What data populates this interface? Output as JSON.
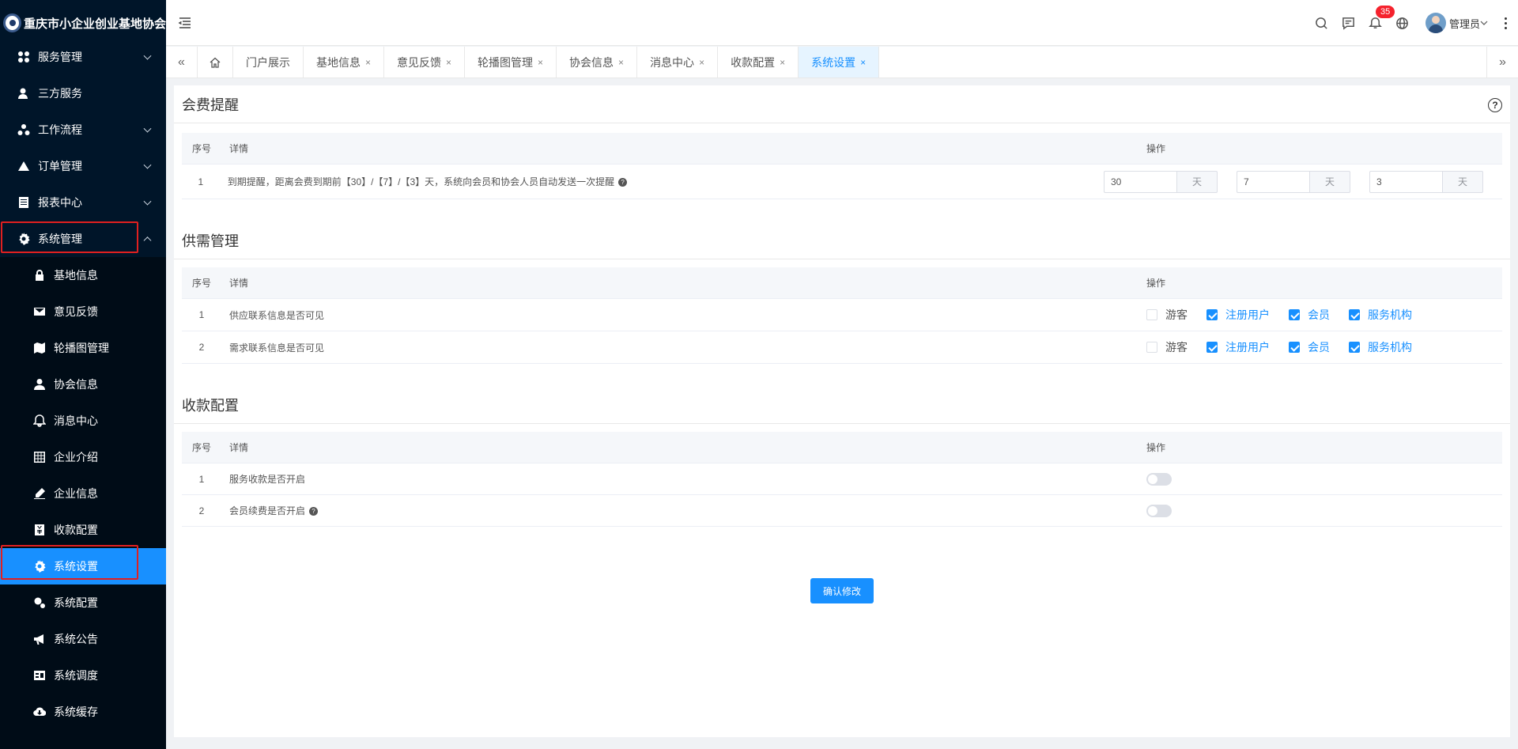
{
  "app": {
    "title": "重庆市小企业创业基地协会"
  },
  "sidebar": {
    "items": [
      {
        "label": "服务管理"
      },
      {
        "label": "三方服务"
      },
      {
        "label": "工作流程"
      },
      {
        "label": "订单管理"
      },
      {
        "label": "报表中心"
      },
      {
        "label": "系统管理"
      },
      {
        "label": "基地信息"
      },
      {
        "label": "意见反馈"
      },
      {
        "label": "轮播图管理"
      },
      {
        "label": "协会信息"
      },
      {
        "label": "消息中心"
      },
      {
        "label": "企业介绍"
      },
      {
        "label": "企业信息"
      },
      {
        "label": "收款配置"
      },
      {
        "label": "系统设置"
      },
      {
        "label": "系统配置"
      },
      {
        "label": "系统公告"
      },
      {
        "label": "系统调度"
      },
      {
        "label": "系统缓存"
      }
    ]
  },
  "header": {
    "notification_count": "35",
    "user_name": "管理员"
  },
  "tabs": [
    {
      "label": "门户展示"
    },
    {
      "label": "基地信息"
    },
    {
      "label": "意见反馈"
    },
    {
      "label": "轮播图管理"
    },
    {
      "label": "协会信息"
    },
    {
      "label": "消息中心"
    },
    {
      "label": "收款配置"
    },
    {
      "label": "系统设置"
    }
  ],
  "tab_close": "×",
  "sections": {
    "fee": {
      "title": "会费提醒",
      "head": {
        "index": "序号",
        "detail": "详情",
        "action": "操作"
      },
      "row": {
        "index": "1",
        "detail": "到期提醒，距离会费到期前【30】/【7】/【3】天，系统向会员和协会人员自动发送一次提醒",
        "values": [
          "30",
          "7",
          "3"
        ],
        "unit": "天"
      }
    },
    "supply": {
      "title": "供需管理",
      "head": {
        "index": "序号",
        "detail": "详情",
        "action": "操作"
      },
      "rows": [
        {
          "index": "1",
          "detail": "供应联系信息是否可见"
        },
        {
          "index": "2",
          "detail": "需求联系信息是否可见"
        }
      ],
      "options": [
        "游客",
        "注册用户",
        "会员",
        "服务机构"
      ]
    },
    "payment": {
      "title": "收款配置",
      "head": {
        "index": "序号",
        "detail": "详情",
        "action": "操作"
      },
      "rows": [
        {
          "index": "1",
          "detail": "服务收款是否开启",
          "enabled": false
        },
        {
          "index": "2",
          "detail": "会员续费是否开启",
          "enabled": false
        }
      ]
    }
  },
  "confirm_label": "确认修改",
  "colors": {
    "sidebar_bg": "#001529",
    "accent": "#1890ff",
    "highlight": "#e02020"
  }
}
